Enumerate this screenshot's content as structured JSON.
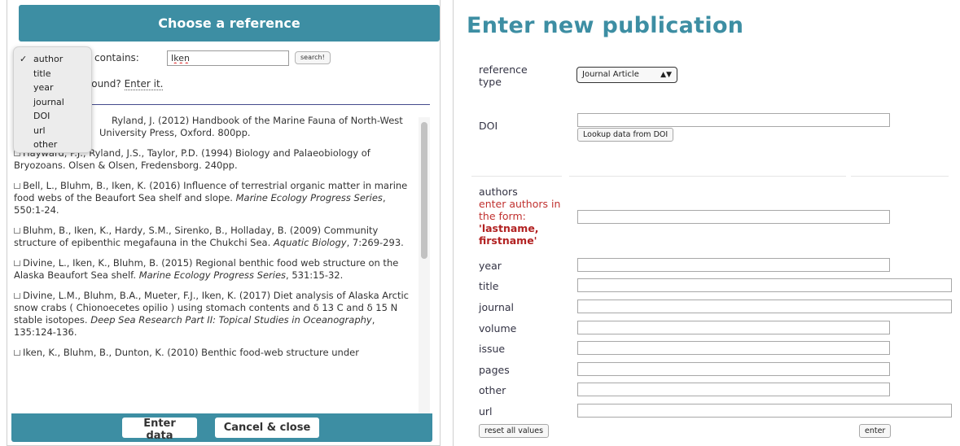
{
  "left": {
    "header_title": "Choose a reference",
    "contains_label": "contains:",
    "search_value": "Iken",
    "search_button": "search!",
    "not_found_prefix": "found?",
    "enter_it_link": "Enter it.",
    "field_options": [
      "author",
      "title",
      "year",
      "journal",
      "DOI",
      "url",
      "other"
    ],
    "selected_field": "author",
    "references": [
      {
        "pre": "Ryland, J. (2012) Handbook of the Marine Fauna of North-West",
        "pre2": "University Press, Oxford. 800pp.",
        "journal": "",
        "post": ""
      },
      {
        "pre": "Hayward, P.J., Ryland, J.S., Taylor, P.D. (1994) Biology and Palaeobiology of Bryozoans. Olsen & Olsen, Fredensborg. 240pp.",
        "journal": "",
        "post": ""
      },
      {
        "pre": "Bell, L., Bluhm, B., Iken, K. (2016) Influence of terrestrial organic matter in marine food webs of the Beaufort Sea shelf and slope. ",
        "journal": "Marine Ecology Progress Series",
        "post": ", 550:1-24."
      },
      {
        "pre": "Bluhm, B., Iken, K., Hardy, S.M., Sirenko, B., Holladay, B. (2009) Community structure of epibenthic megafauna in the Chukchi Sea. ",
        "journal": "Aquatic Biology",
        "post": ", 7:269-293."
      },
      {
        "pre": "Divine, L., Iken, K., Bluhm, B. (2015) Regional benthic food web structure on the Alaska Beaufort Sea shelf. ",
        "journal": "Marine Ecology Progress Series",
        "post": ", 531:15-32."
      },
      {
        "pre": "Divine, L.M., Bluhm, B.A., Mueter, F.J., Iken, K. (2017) Diet analysis of Alaska Arctic snow crabs ( Chionoecetes opilio ) using stomach contents and δ 13 C and δ 15 N stable isotopes. ",
        "journal": "Deep Sea Research Part II: Topical Studies in Oceanography",
        "post": ", 135:124-136."
      },
      {
        "pre": "Iken, K., Bluhm, B., Dunton, K. (2010) Benthic food-web structure under",
        "journal": "",
        "post": ""
      }
    ],
    "enter_data_button": "Enter data",
    "cancel_button": "Cancel & close"
  },
  "right": {
    "title": "Enter new publication",
    "reference_type_label": "reference type",
    "reference_type_value": "Journal Article",
    "doi_label": "DOI",
    "lookup_button": "Lookup data from DOI",
    "authors_label": "authors",
    "authors_hint": "enter authors in the form:",
    "authors_format": "'lastname, firstname'",
    "fields": [
      "year",
      "title",
      "journal",
      "volume",
      "issue",
      "pages",
      "other",
      "url"
    ],
    "reset_button": "reset all values",
    "enter_button": "enter"
  }
}
